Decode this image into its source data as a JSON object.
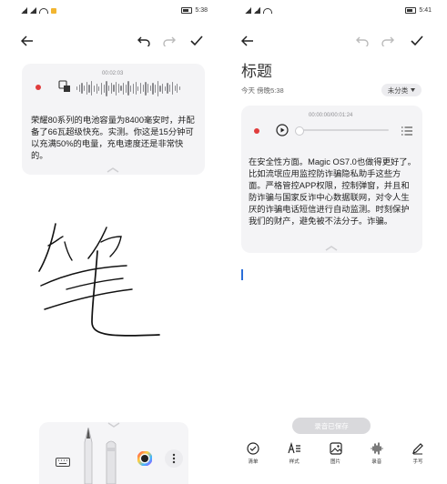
{
  "left": {
    "status": {
      "time": "5:38"
    },
    "toolbar": {
      "back": "back-arrow-icon",
      "undo": "undo-icon",
      "redo": "redo-icon",
      "done": "check-icon"
    },
    "audio": {
      "timer": "00:02:03"
    },
    "note_text": "荣耀80系列的电池容量为8400毫安时，并配备了66瓦超级快充。实测。你这是15分钟可以充满50%的电量，充电速度还是非常快的。",
    "handwriting": "笔",
    "pen_tools": [
      "keyboard-icon",
      "fountain-pen-tool",
      "marker-tool",
      "color-picker",
      "more-icon"
    ]
  },
  "right": {
    "status": {
      "time": "5:41"
    },
    "title": "标题",
    "subtitle": "今天 傍晚5:38",
    "category": "未分类",
    "audio": {
      "timer": "00:00:00/00:01:24"
    },
    "note_text": "在安全性方面。Magic OS7.0也做得更好了。比如流氓应用监控防诈骗隐私助手这些方面。严格管控APP权限，控制弹窗，并且和防诈骗与国家反诈中心数据联网，对令人生厌的诈骗电话短信进行自动监测。时刻保护我们的财产，避免被不法分子。诈骗。",
    "saved_pill": "录音已保存",
    "bottom_bar": [
      {
        "label": "清单",
        "icon": "checklist-icon"
      },
      {
        "label": "样式",
        "icon": "text-style-icon"
      },
      {
        "label": "图片",
        "icon": "image-icon"
      },
      {
        "label": "录音",
        "icon": "audio-wave-icon"
      },
      {
        "label": "手写",
        "icon": "handwriting-pen-icon"
      }
    ]
  }
}
